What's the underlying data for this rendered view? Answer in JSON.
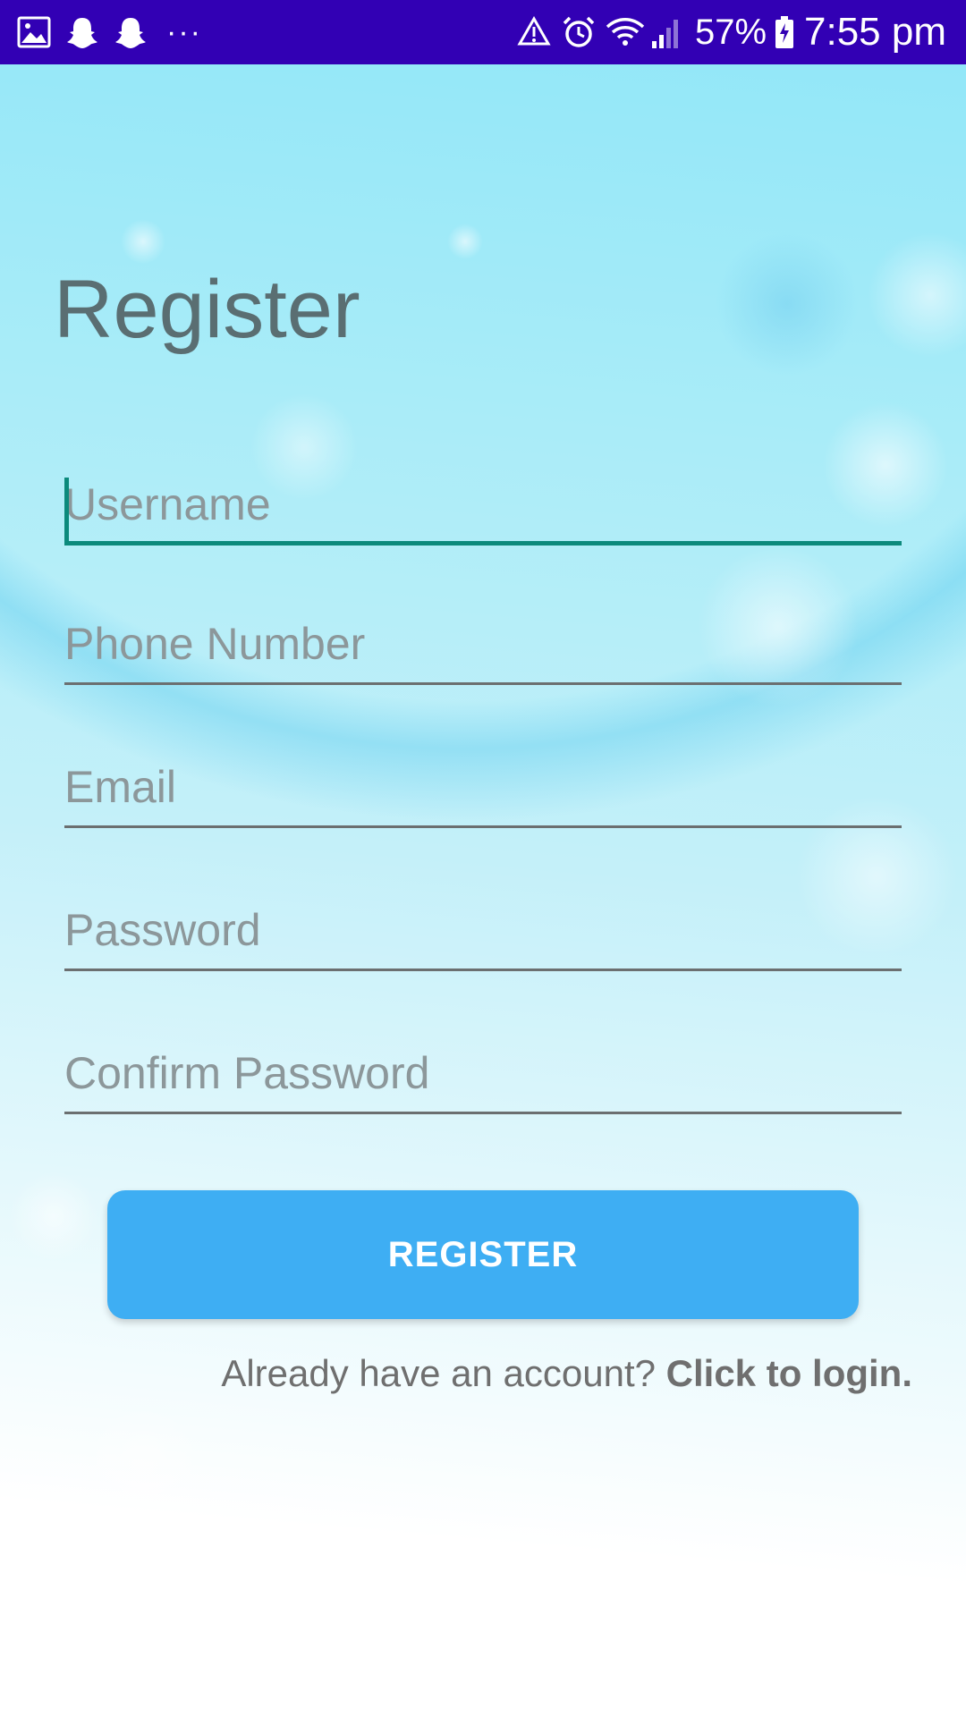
{
  "status_bar": {
    "battery": "57%",
    "time": "7:55 pm",
    "overflow": "···",
    "icons_left": [
      "gallery-icon",
      "snapchat-icon",
      "snapchat-icon"
    ],
    "icons_right": [
      "data-saver-icon",
      "alarm-icon",
      "wifi-icon",
      "signal-icon",
      "battery-icon"
    ]
  },
  "title": "Register",
  "form": {
    "username_placeholder": "Username",
    "phone_placeholder": "Phone Number",
    "email_placeholder": "Email",
    "password_placeholder": "Password",
    "confirm_password_placeholder": "Confirm Password",
    "focused_field": "username"
  },
  "register_button": "REGISTER",
  "login_prompt": {
    "text": "Already have an account? ",
    "link": "Click to login."
  },
  "colors": {
    "status_bar": "#3200b4",
    "button": "#3eaef3",
    "focus_accent": "#0c8a7c",
    "title": "#5a6e72"
  }
}
